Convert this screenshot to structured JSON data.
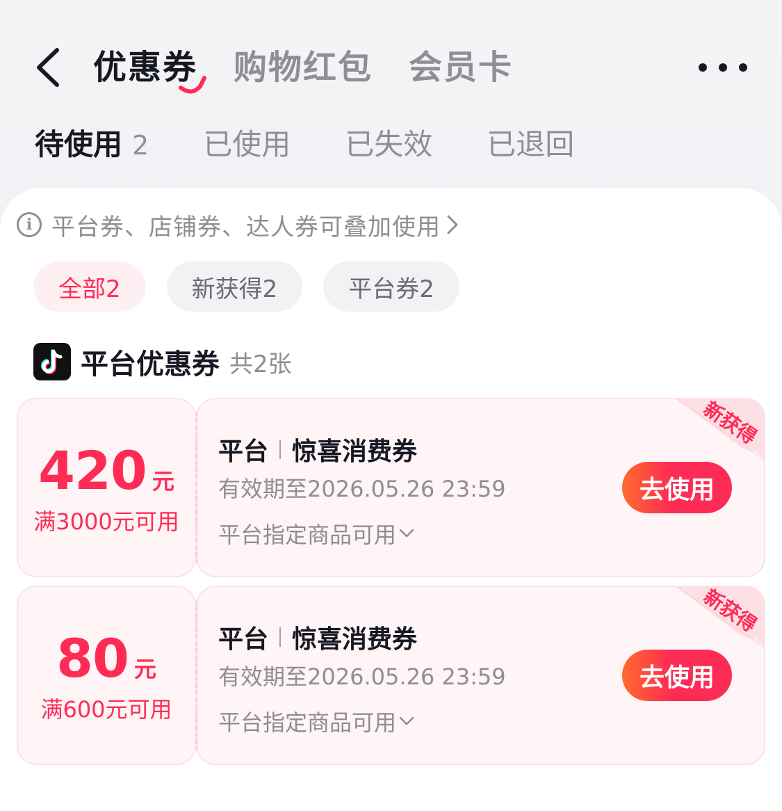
{
  "header": {
    "tabs": [
      {
        "label": "优惠券",
        "active": true
      },
      {
        "label": "购物红包",
        "active": false
      },
      {
        "label": "会员卡",
        "active": false
      }
    ]
  },
  "status_tabs": [
    {
      "label": "待使用",
      "count": "2",
      "active": true
    },
    {
      "label": "已使用",
      "count": "",
      "active": false
    },
    {
      "label": "已失效",
      "count": "",
      "active": false
    },
    {
      "label": "已退回",
      "count": "",
      "active": false
    }
  ],
  "notice": {
    "text": "平台券、店铺券、达人券可叠加使用"
  },
  "filters": [
    {
      "label": "全部2",
      "active": true
    },
    {
      "label": "新获得2",
      "active": false
    },
    {
      "label": "平台券2",
      "active": false
    }
  ],
  "section": {
    "title": "平台优惠券",
    "count_text": "共2张"
  },
  "coupons": [
    {
      "amount": "420",
      "unit": "元",
      "threshold": "满3000元可用",
      "tag": "平台",
      "name": "惊喜消费券",
      "validity": "有效期至2026.05.26 23:59",
      "scope": "平台指定商品可用",
      "button": "去使用",
      "ribbon": "新获得"
    },
    {
      "amount": "80",
      "unit": "元",
      "threshold": "满600元可用",
      "tag": "平台",
      "name": "惊喜消费券",
      "validity": "有效期至2026.05.26 23:59",
      "scope": "平台指定商品可用",
      "button": "去使用",
      "ribbon": "新获得"
    }
  ],
  "colors": {
    "accent": "#fe2c55",
    "text_primary": "#161823",
    "text_secondary": "#8e8e94",
    "card_bg": "#fff4f6"
  }
}
